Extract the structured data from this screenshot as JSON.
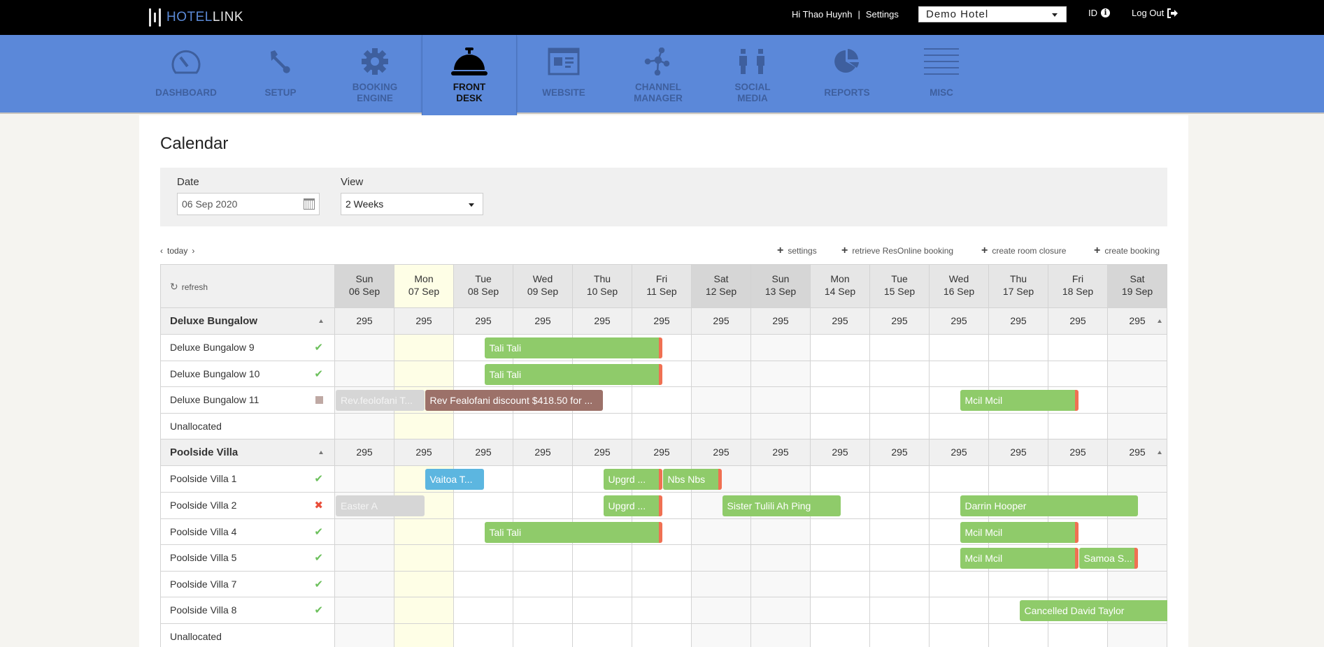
{
  "topbar": {
    "logo_part1": "HOTEL",
    "logo_part2": "LINK",
    "greeting": "Hi Thao Huynh",
    "separator": "|",
    "settings": "Settings",
    "hotel_select": "Demo Hotel",
    "id_label": "ID",
    "logout": "Log Out"
  },
  "nav": [
    {
      "label1": "DASHBOARD",
      "label2": "",
      "icon": "dashboard-gauge-icon",
      "active": false
    },
    {
      "label1": "SETUP",
      "label2": "",
      "icon": "wrench-icon",
      "active": false
    },
    {
      "label1": "BOOKING",
      "label2": "ENGINE",
      "icon": "gear-icon",
      "active": false
    },
    {
      "label1": "FRONT",
      "label2": "DESK",
      "icon": "service-bell-icon",
      "active": true
    },
    {
      "label1": "WEBSITE",
      "label2": "",
      "icon": "webpage-icon",
      "active": false
    },
    {
      "label1": "CHANNEL",
      "label2": "MANAGER",
      "icon": "network-icon",
      "active": false
    },
    {
      "label1": "SOCIAL",
      "label2": "MEDIA",
      "icon": "people-icon",
      "active": false
    },
    {
      "label1": "REPORTS",
      "label2": "",
      "icon": "pie-chart-icon",
      "active": false
    },
    {
      "label1": "MISC",
      "label2": "",
      "icon": "menu-lines-icon",
      "active": false
    }
  ],
  "page": {
    "title": "Calendar",
    "date_label": "Date",
    "date_value": "06 Sep 2020",
    "view_label": "View",
    "view_value": "2 Weeks",
    "today": "today",
    "actions": [
      "settings",
      "retrieve ResOnline booking",
      "create room closure",
      "create booking"
    ],
    "refresh": "refresh"
  },
  "days": [
    {
      "dow": "Sun",
      "date": "06 Sep",
      "type": "weekend"
    },
    {
      "dow": "Mon",
      "date": "07 Sep",
      "type": "today"
    },
    {
      "dow": "Tue",
      "date": "08 Sep",
      "type": ""
    },
    {
      "dow": "Wed",
      "date": "09 Sep",
      "type": ""
    },
    {
      "dow": "Thu",
      "date": "10 Sep",
      "type": ""
    },
    {
      "dow": "Fri",
      "date": "11 Sep",
      "type": ""
    },
    {
      "dow": "Sat",
      "date": "12 Sep",
      "type": "weekend"
    },
    {
      "dow": "Sun",
      "date": "13 Sep",
      "type": "weekend"
    },
    {
      "dow": "Mon",
      "date": "14 Sep",
      "type": ""
    },
    {
      "dow": "Tue",
      "date": "15 Sep",
      "type": ""
    },
    {
      "dow": "Wed",
      "date": "16 Sep",
      "type": ""
    },
    {
      "dow": "Thu",
      "date": "17 Sep",
      "type": ""
    },
    {
      "dow": "Fri",
      "date": "18 Sep",
      "type": ""
    },
    {
      "dow": "Sat",
      "date": "19 Sep",
      "type": "weekend"
    }
  ],
  "categories": [
    {
      "name": "Deluxe Bungalow",
      "rates": [
        "295",
        "295",
        "295",
        "295",
        "295",
        "295",
        "295",
        "295",
        "295",
        "295",
        "295",
        "295",
        "295",
        "295"
      ],
      "rooms": [
        {
          "name": "Deluxe Bungalow 9",
          "status": "ok",
          "bookings": [
            {
              "label": "Tali Tali",
              "start": 2.5,
              "end": 5.5,
              "color": "green",
              "flag": true
            }
          ]
        },
        {
          "name": "Deluxe Bungalow 10",
          "status": "ok",
          "bookings": [
            {
              "label": "Tali Tali",
              "start": 2.5,
              "end": 5.5,
              "color": "green",
              "flag": true
            }
          ]
        },
        {
          "name": "Deluxe Bungalow 11",
          "status": "closed",
          "bookings": [
            {
              "label": "Rev.feolofani T...",
              "start": 0,
              "end": 1.5,
              "color": "grey",
              "flag": false
            },
            {
              "label": "Rev Fealofani discount $418.50 for ...",
              "start": 1.5,
              "end": 4.5,
              "color": "brown",
              "flag": false
            },
            {
              "label": "Mcil Mcil",
              "start": 10.5,
              "end": 12.5,
              "color": "green",
              "flag": true
            }
          ]
        },
        {
          "name": "Unallocated",
          "status": "",
          "bookings": []
        }
      ]
    },
    {
      "name": "Poolside Villa",
      "rates": [
        "295",
        "295",
        "295",
        "295",
        "295",
        "295",
        "295",
        "295",
        "295",
        "295",
        "295",
        "295",
        "295",
        "295"
      ],
      "rooms": [
        {
          "name": "Poolside Villa 1",
          "status": "ok",
          "bookings": [
            {
              "label": "Vaitoa T...",
              "start": 1.5,
              "end": 2.5,
              "color": "blue",
              "flag": false
            },
            {
              "label": "Upgrd ...",
              "start": 4.5,
              "end": 5.5,
              "color": "green",
              "flag": true
            },
            {
              "label": "Nbs Nbs",
              "start": 5.5,
              "end": 6.5,
              "color": "green",
              "flag": true
            }
          ]
        },
        {
          "name": "Poolside Villa 2",
          "status": "bad",
          "bookings": [
            {
              "label": "Easter A",
              "start": 0,
              "end": 1.5,
              "color": "grey",
              "flag": false
            },
            {
              "label": "Upgrd ...",
              "start": 4.5,
              "end": 5.5,
              "color": "green",
              "flag": true
            },
            {
              "label": "Sister Tulili Ah Ping",
              "start": 6.5,
              "end": 8.5,
              "color": "green",
              "flag": false
            },
            {
              "label": "Darrin Hooper",
              "start": 10.5,
              "end": 13.5,
              "color": "green",
              "flag": false
            }
          ]
        },
        {
          "name": "Poolside Villa 4",
          "status": "ok",
          "bookings": [
            {
              "label": "Tali Tali",
              "start": 2.5,
              "end": 5.5,
              "color": "green",
              "flag": true
            },
            {
              "label": "Mcil Mcil",
              "start": 10.5,
              "end": 12.5,
              "color": "green",
              "flag": true
            }
          ]
        },
        {
          "name": "Poolside Villa 5",
          "status": "ok",
          "bookings": [
            {
              "label": "Mcil Mcil",
              "start": 10.5,
              "end": 12.5,
              "color": "green",
              "flag": true
            },
            {
              "label": "Samoa S...",
              "start": 12.5,
              "end": 13.5,
              "color": "green",
              "flag": true
            }
          ]
        },
        {
          "name": "Poolside Villa 7",
          "status": "ok",
          "bookings": []
        },
        {
          "name": "Poolside Villa 8",
          "status": "ok",
          "bookings": [
            {
              "label": "Cancelled David Taylor",
              "start": 11.5,
              "end": 14,
              "color": "green",
              "flag": false
            }
          ]
        },
        {
          "name": "Unallocated",
          "status": "",
          "bookings": []
        }
      ]
    }
  ]
}
